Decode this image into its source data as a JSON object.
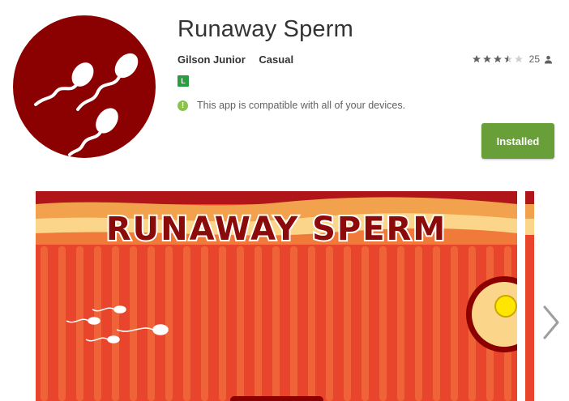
{
  "app": {
    "title": "Runaway Sperm",
    "developer": "Gilson Junior",
    "category": "Casual",
    "content_rating_badge": "L",
    "compatibility": "This app is compatible with all of your devices.",
    "install_label": "Installed",
    "rating_count": "25",
    "rating_stars": 3.5,
    "icon": "sperm-app-icon"
  },
  "screenshots": {
    "banner_text": "RUNAWAY SPERM",
    "next_icon": "chevron-right-icon"
  },
  "colors": {
    "icon_bg": "#8b0000",
    "install_button": "#689f38",
    "badge": "#2c9d3f",
    "compat_icon": "#8bc34a",
    "screenshot_bg": "#e8452c"
  }
}
